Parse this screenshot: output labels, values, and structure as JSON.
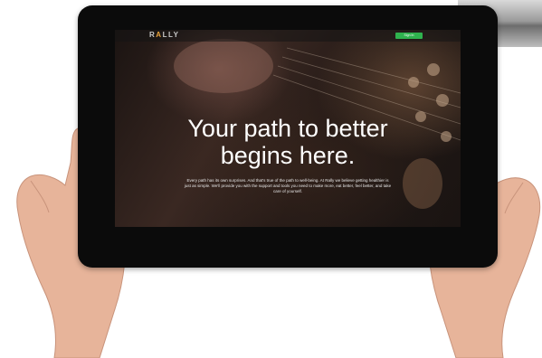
{
  "brand": {
    "logo_prefix": "R",
    "logo_accent": "A",
    "logo_suffix": "LLY"
  },
  "nav": {
    "cta_label": "Sign In",
    "cta_sub": ""
  },
  "hero": {
    "headline_line1": "Your path to better",
    "headline_line2": "begins here.",
    "subtext": "Every path has its own surprises. And that's true of the path to well-being. At Rally we believe getting healthier is just as simple. We'll provide you with the support and tools you need to make more, eat better, feel better, and take care of yourself."
  },
  "colors": {
    "accent": "#e8a23b",
    "cta_green": "#2fb24e",
    "bezel": "#0b0b0b"
  }
}
